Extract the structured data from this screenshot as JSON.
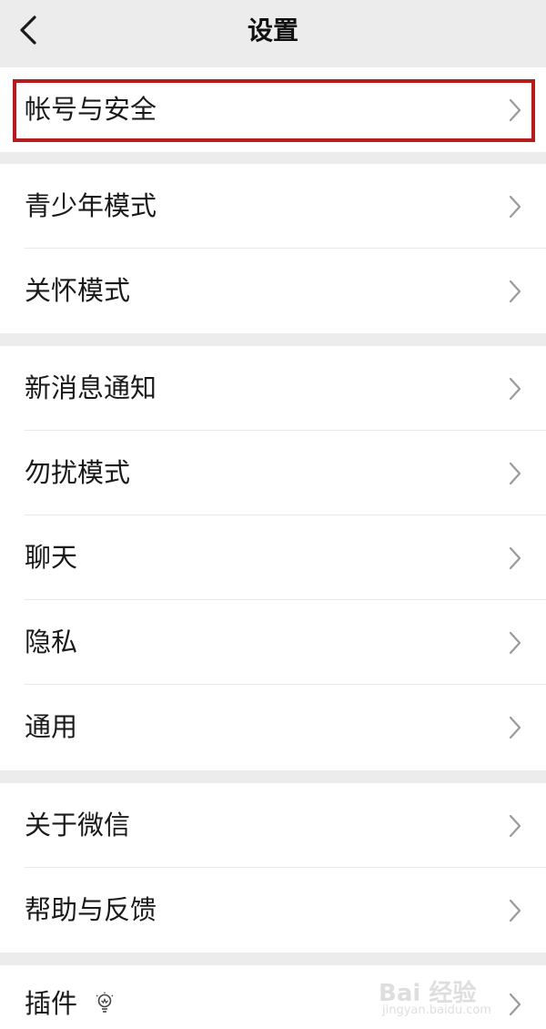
{
  "header": {
    "title": "设置",
    "back_icon": "chevron-left-icon"
  },
  "sections": [
    {
      "items": [
        {
          "label": "帐号与安全",
          "highlighted": true
        }
      ]
    },
    {
      "items": [
        {
          "label": "青少年模式"
        },
        {
          "label": "关怀模式"
        }
      ]
    },
    {
      "items": [
        {
          "label": "新消息通知"
        },
        {
          "label": "勿扰模式"
        },
        {
          "label": "聊天"
        },
        {
          "label": "隐私"
        },
        {
          "label": "通用"
        }
      ]
    },
    {
      "items": [
        {
          "label": "关于微信"
        },
        {
          "label": "帮助与反馈"
        }
      ]
    },
    {
      "items": [
        {
          "label": "插件",
          "icon": "lightbulb-icon"
        }
      ]
    }
  ],
  "watermark": {
    "text": "Bai 经验",
    "sub": "jingyan.baidu.com"
  },
  "colors": {
    "highlight_border": "#b71c1c",
    "background": "#ececec",
    "row_background": "#ffffff"
  }
}
